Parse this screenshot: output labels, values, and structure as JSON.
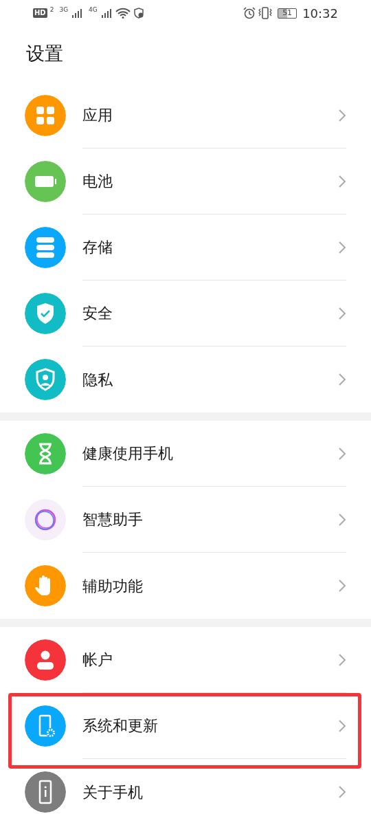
{
  "status_bar": {
    "hd": "HD",
    "sim": "2",
    "net1": "3G",
    "net2": "4G",
    "battery": "51",
    "time": "10:32"
  },
  "title": "设置",
  "groups": [
    {
      "items": [
        {
          "label": "应用",
          "kind": "apps",
          "color": "#ff9800",
          "highlighted": false
        },
        {
          "label": "电池",
          "kind": "battery",
          "color": "#66c454",
          "highlighted": false
        },
        {
          "label": "存储",
          "kind": "storage",
          "color": "#0aa8fa",
          "highlighted": false
        },
        {
          "label": "安全",
          "kind": "security",
          "color": "#12bcc4",
          "highlighted": false
        },
        {
          "label": "隐私",
          "kind": "privacy",
          "color": "#12bcc4",
          "highlighted": false
        }
      ]
    },
    {
      "items": [
        {
          "label": "健康使用手机",
          "kind": "hourglass",
          "color": "#44c553",
          "highlighted": false
        },
        {
          "label": "智慧助手",
          "kind": "ring",
          "color": "#f6eef8",
          "highlighted": false
        },
        {
          "label": "辅助功能",
          "kind": "hand",
          "color": "#ff9800",
          "highlighted": false
        }
      ]
    },
    {
      "items": [
        {
          "label": "帐户",
          "kind": "account",
          "color": "#f5333b",
          "highlighted": false
        },
        {
          "label": "系统和更新",
          "kind": "system",
          "color": "#0aa8fa",
          "highlighted": true
        },
        {
          "label": "关于手机",
          "kind": "about",
          "color": "#7d7d7d",
          "highlighted": false
        }
      ]
    }
  ]
}
